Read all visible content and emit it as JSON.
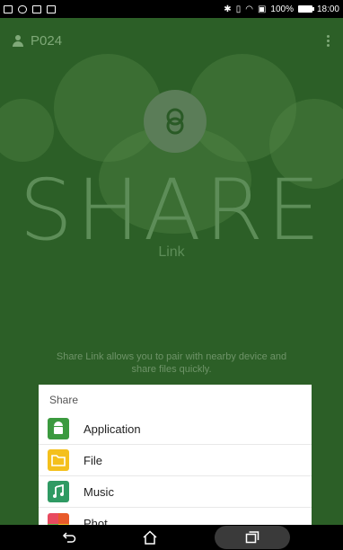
{
  "status_bar": {
    "battery": "100%",
    "time": "18:00"
  },
  "header": {
    "device_name": "P024"
  },
  "hero": {
    "title": "SHARE",
    "subtitle": "Link",
    "description": "Share Link allows you to pair with nearby device and share files quickly."
  },
  "share_sheet": {
    "title": "Share",
    "items": [
      {
        "label": "Application",
        "icon": "android-icon"
      },
      {
        "label": "File",
        "icon": "folder-icon"
      },
      {
        "label": "Music",
        "icon": "music-note-icon"
      },
      {
        "label": "Phot",
        "icon": "photo-icon"
      }
    ]
  },
  "colors": {
    "background": "#2c5f27",
    "accent": "#5d8d58",
    "sheet": "#ffffff"
  }
}
